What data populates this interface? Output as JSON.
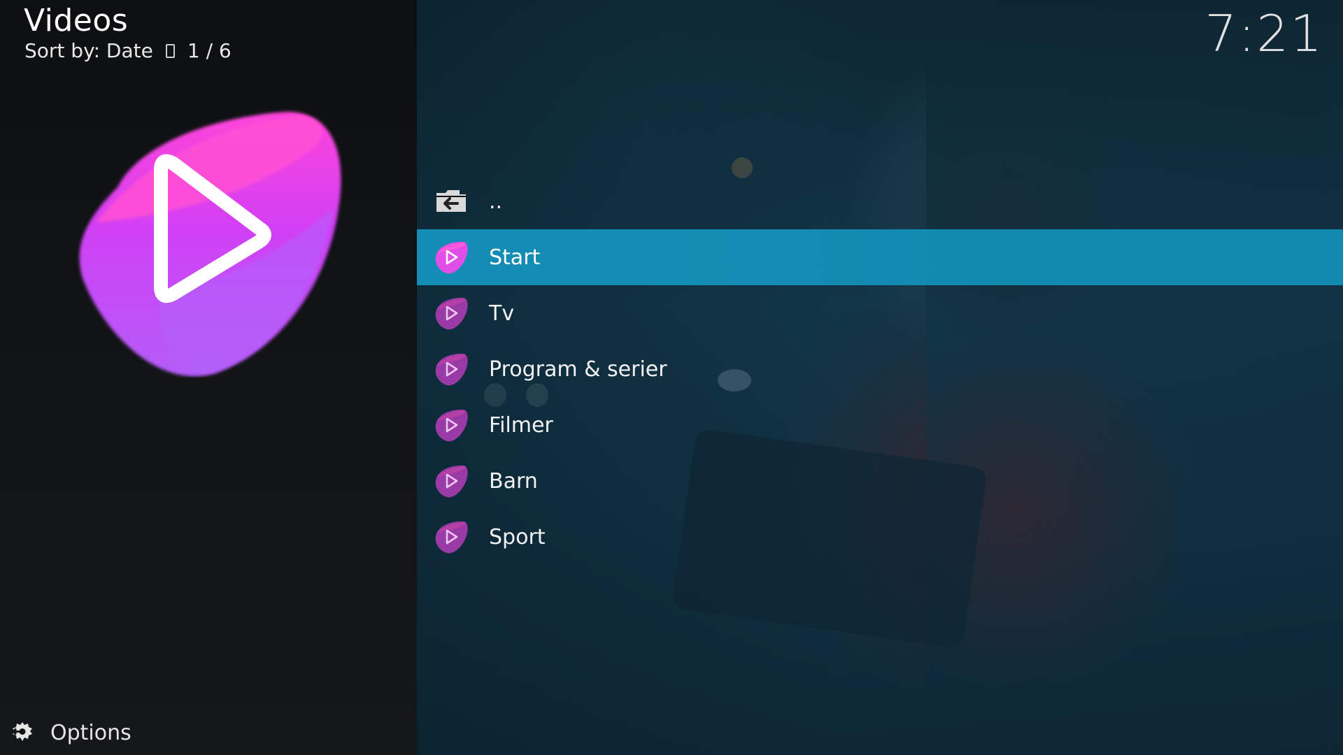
{
  "header": {
    "title": "Videos",
    "sort_label": "Sort by: Date",
    "page_counter": "1 / 6"
  },
  "clock": "7:21",
  "list": {
    "items": [
      {
        "label": "..",
        "icon": "folder-back-icon"
      },
      {
        "label": "Start",
        "icon": "play-addon-icon",
        "selected": true
      },
      {
        "label": "Tv",
        "icon": "play-addon-icon"
      },
      {
        "label": "Program & serier",
        "icon": "play-addon-icon"
      },
      {
        "label": "Filmer",
        "icon": "play-addon-icon"
      },
      {
        "label": "Barn",
        "icon": "play-addon-icon"
      },
      {
        "label": "Sport",
        "icon": "play-addon-icon"
      }
    ]
  },
  "footer": {
    "options_label": "Options",
    "options_icon": "options-gear-icon"
  },
  "colors": {
    "selection": "#1188ad",
    "logo_pink": "#ff4fd8",
    "logo_purple": "#c54bf5"
  }
}
